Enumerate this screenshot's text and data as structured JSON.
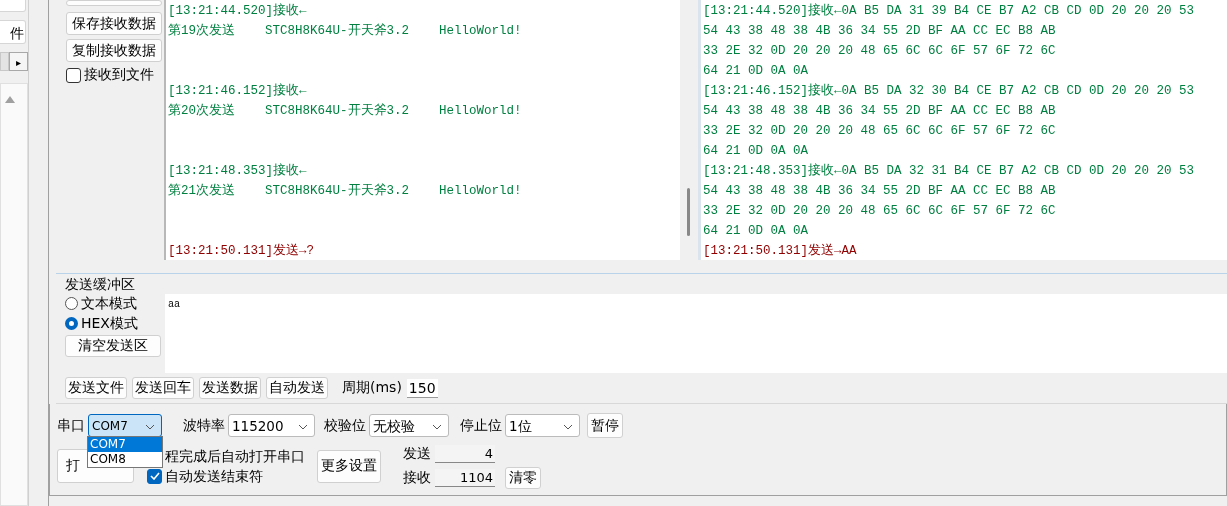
{
  "left_panel": {
    "items": [
      "件"
    ],
    "tab_arrow": "▸"
  },
  "receive_buttons": [
    {
      "label": "保存接收数据"
    },
    {
      "label": "复制接收数据"
    }
  ],
  "receive_to_file": {
    "label": "接收到文件",
    "checked": false
  },
  "text_log": [
    {
      "kind": "recv",
      "header": "[13:21:44.520]接收←",
      "body": "第19次发送    STC8H8K64U-开天斧3.2    HelloWorld!"
    },
    {
      "kind": "recv",
      "header": "[13:21:46.152]接收←",
      "body": "第20次发送    STC8H8K64U-开天斧3.2    HelloWorld!"
    },
    {
      "kind": "recv",
      "header": "[13:21:48.353]接收←",
      "body": "第21次发送    STC8H8K64U-开天斧3.2    HelloWorld!"
    },
    {
      "kind": "send",
      "header": "[13:21:50.131]发送→?"
    }
  ],
  "hex_log": [
    {
      "kind": "recv",
      "lines": [
        "[13:21:44.520]接收←0A B5 DA 31 39 B4 CE B7 A2 CB CD 0D 20 20 20 53",
        "54 43 38 48 38 4B 36 34 55 2D BF AA CC EC B8 AB",
        "33 2E 32 0D 20 20 20 48 65 6C 6C 6F 57 6F 72 6C",
        "64 21 0D 0A 0A"
      ]
    },
    {
      "kind": "recv",
      "lines": [
        "[13:21:46.152]接收←0A B5 DA 32 30 B4 CE B7 A2 CB CD 0D 20 20 20 53",
        "54 43 38 48 38 4B 36 34 55 2D BF AA CC EC B8 AB",
        "33 2E 32 0D 20 20 20 48 65 6C 6C 6F 57 6F 72 6C",
        "64 21 0D 0A 0A"
      ]
    },
    {
      "kind": "recv",
      "lines": [
        "[13:21:48.353]接收←0A B5 DA 32 31 B4 CE B7 A2 CB CD 0D 20 20 20 53",
        "54 43 38 48 38 4B 36 34 55 2D BF AA CC EC B8 AB",
        "33 2E 32 0D 20 20 20 48 65 6C 6C 6F 57 6F 72 6C",
        "64 21 0D 0A 0A"
      ]
    },
    {
      "kind": "send",
      "lines": [
        "[13:21:50.131]发送→AA"
      ]
    }
  ],
  "send_buffer": {
    "title": "发送缓冲区",
    "modes": [
      {
        "label": "文本模式",
        "selected": false
      },
      {
        "label": "HEX模式",
        "selected": true
      }
    ],
    "clear_button": "清空发送区",
    "value": "aa"
  },
  "send_buttons": [
    "发送文件",
    "发送回车",
    "发送数据",
    "自动发送"
  ],
  "period": {
    "label": "周期(ms)",
    "value": "150"
  },
  "serial": {
    "port_label": "串口",
    "port": "COM7",
    "port_options": [
      {
        "label": "COM7",
        "selected": true
      },
      {
        "label": "COM8",
        "selected": false
      }
    ],
    "baud_label": "波特率",
    "baud": "115200",
    "parity_label": "校验位",
    "parity": "无校验",
    "stop_label": "停止位",
    "stop": "1位",
    "pause_button": "暂停"
  },
  "open_button": "打",
  "options": [
    {
      "label": "程完成后自动打开串口"
    },
    {
      "label": "自动发送结束符",
      "checked": true
    }
  ],
  "more_button": "更多设置",
  "counters": [
    {
      "label": "发送",
      "value": "4"
    },
    {
      "label": "接收",
      "value": "1104"
    }
  ],
  "clear_counters_button": "清零"
}
